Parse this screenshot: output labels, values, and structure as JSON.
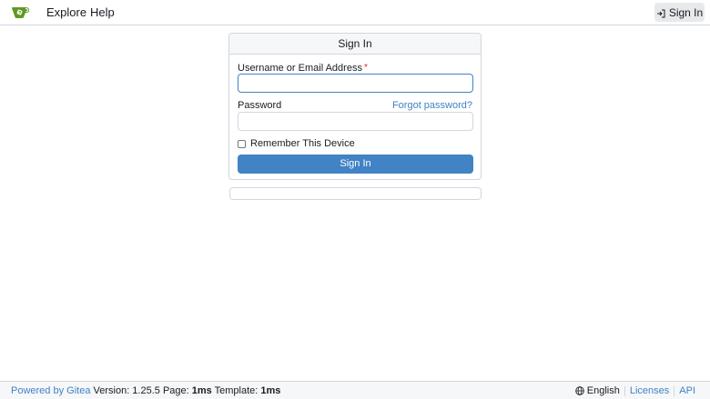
{
  "navbar": {
    "explore_label": "Explore",
    "help_label": "Help",
    "signin_label": "Sign In",
    "logo_icon": "gitea-logo-icon",
    "signin_icon": "sign-in-icon"
  },
  "login": {
    "title": "Sign In",
    "username_label": "Username or Email Address",
    "required_mark": "*",
    "username_value": "",
    "password_label": "Password",
    "password_value": "",
    "forgot_label": "Forgot password?",
    "remember_label": "Remember This Device",
    "remember_checked": false,
    "submit_label": "Sign In"
  },
  "footer": {
    "powered_label": "Powered by Gitea",
    "version_text": "Version: 1.25.5 Page:",
    "page_time": "1ms",
    "template_text": "Template:",
    "template_time": "1ms",
    "language_label": "English",
    "language_icon": "globe-icon",
    "licenses_label": "Licenses",
    "api_label": "API"
  },
  "colors": {
    "accent": "#4183c4",
    "border": "#d0d7de",
    "logo_green": "#609926",
    "required": "#db2828"
  }
}
